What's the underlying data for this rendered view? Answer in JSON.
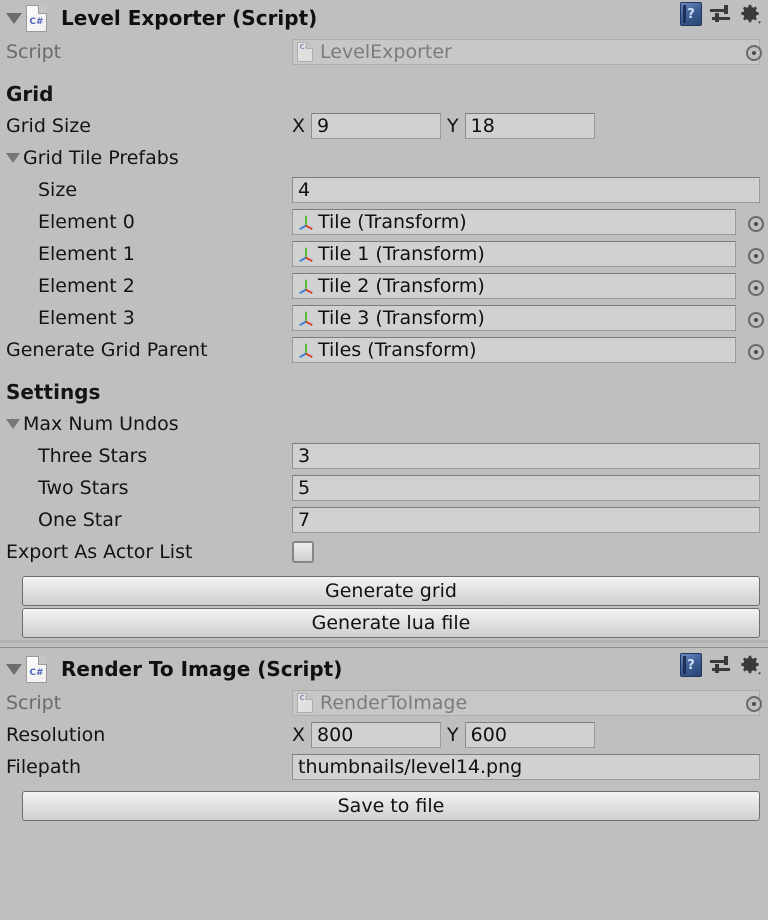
{
  "components": [
    {
      "id": "level-exporter",
      "title": "Level Exporter (Script)",
      "script_label": "Script",
      "script_value": "LevelExporter",
      "icons": {
        "help": "?",
        "help_name": "help-icon",
        "preset_name": "preset-icon",
        "gear_name": "gear-icon"
      },
      "sections": [
        {
          "heading": "Grid",
          "rows": [
            {
              "kind": "vector2",
              "label": "Grid Size",
              "x_axis": "X",
              "x_value": "9",
              "y_axis": "Y",
              "y_value": "18"
            },
            {
              "kind": "foldout",
              "label": "Grid Tile Prefabs"
            },
            {
              "kind": "text",
              "label": "Size",
              "indent": 1,
              "value": "4"
            },
            {
              "kind": "object",
              "label": "Element 0",
              "indent": 1,
              "value": "Tile (Transform)"
            },
            {
              "kind": "object",
              "label": "Element 1",
              "indent": 1,
              "value": "Tile 1 (Transform)"
            },
            {
              "kind": "object",
              "label": "Element 2",
              "indent": 1,
              "value": "Tile 2 (Transform)"
            },
            {
              "kind": "object",
              "label": "Element 3",
              "indent": 1,
              "value": "Tile 3 (Transform)"
            },
            {
              "kind": "object",
              "label": "Generate Grid Parent",
              "indent": 0,
              "value": "Tiles (Transform)"
            }
          ]
        },
        {
          "heading": "Settings",
          "rows": [
            {
              "kind": "foldout",
              "label": "Max Num Undos"
            },
            {
              "kind": "text",
              "label": "Three Stars",
              "indent": 1,
              "value": "3"
            },
            {
              "kind": "text",
              "label": "Two Stars",
              "indent": 1,
              "value": "5"
            },
            {
              "kind": "text",
              "label": "One Star",
              "indent": 1,
              "value": "7"
            },
            {
              "kind": "checkbox",
              "label": "Export As Actor List",
              "checked": false
            }
          ]
        }
      ],
      "buttons": [
        {
          "label": "Generate grid",
          "name": "generate-grid-button"
        },
        {
          "label": "Generate lua file",
          "name": "generate-lua-file-button"
        }
      ]
    },
    {
      "id": "render-to-image",
      "title": "Render To Image (Script)",
      "script_label": "Script",
      "script_value": "RenderToImage",
      "sections": [
        {
          "heading": "",
          "rows": [
            {
              "kind": "vector2",
              "label": "Resolution",
              "x_axis": "X",
              "x_value": "800",
              "y_axis": "Y",
              "y_value": "600"
            },
            {
              "kind": "text",
              "label": "Filepath",
              "indent": 0,
              "value": "thumbnails/level14.png"
            }
          ]
        }
      ],
      "buttons": [
        {
          "label": "Save to file",
          "name": "save-to-file-button"
        }
      ]
    }
  ],
  "icon_glyphs": {
    "cs_label": "C#",
    "help_glyph": "?",
    "transform_gizmo": "transform-gizmo-icon",
    "object_picker": "object-picker-icon"
  },
  "colors": {
    "background": "#bfbfbf",
    "field": "#d1d1d1",
    "text": "#141414",
    "dim_text": "#6b6b6b",
    "axis_green": "#5dba3a",
    "axis_red": "#d8442f",
    "axis_blue": "#3b7fd4"
  }
}
